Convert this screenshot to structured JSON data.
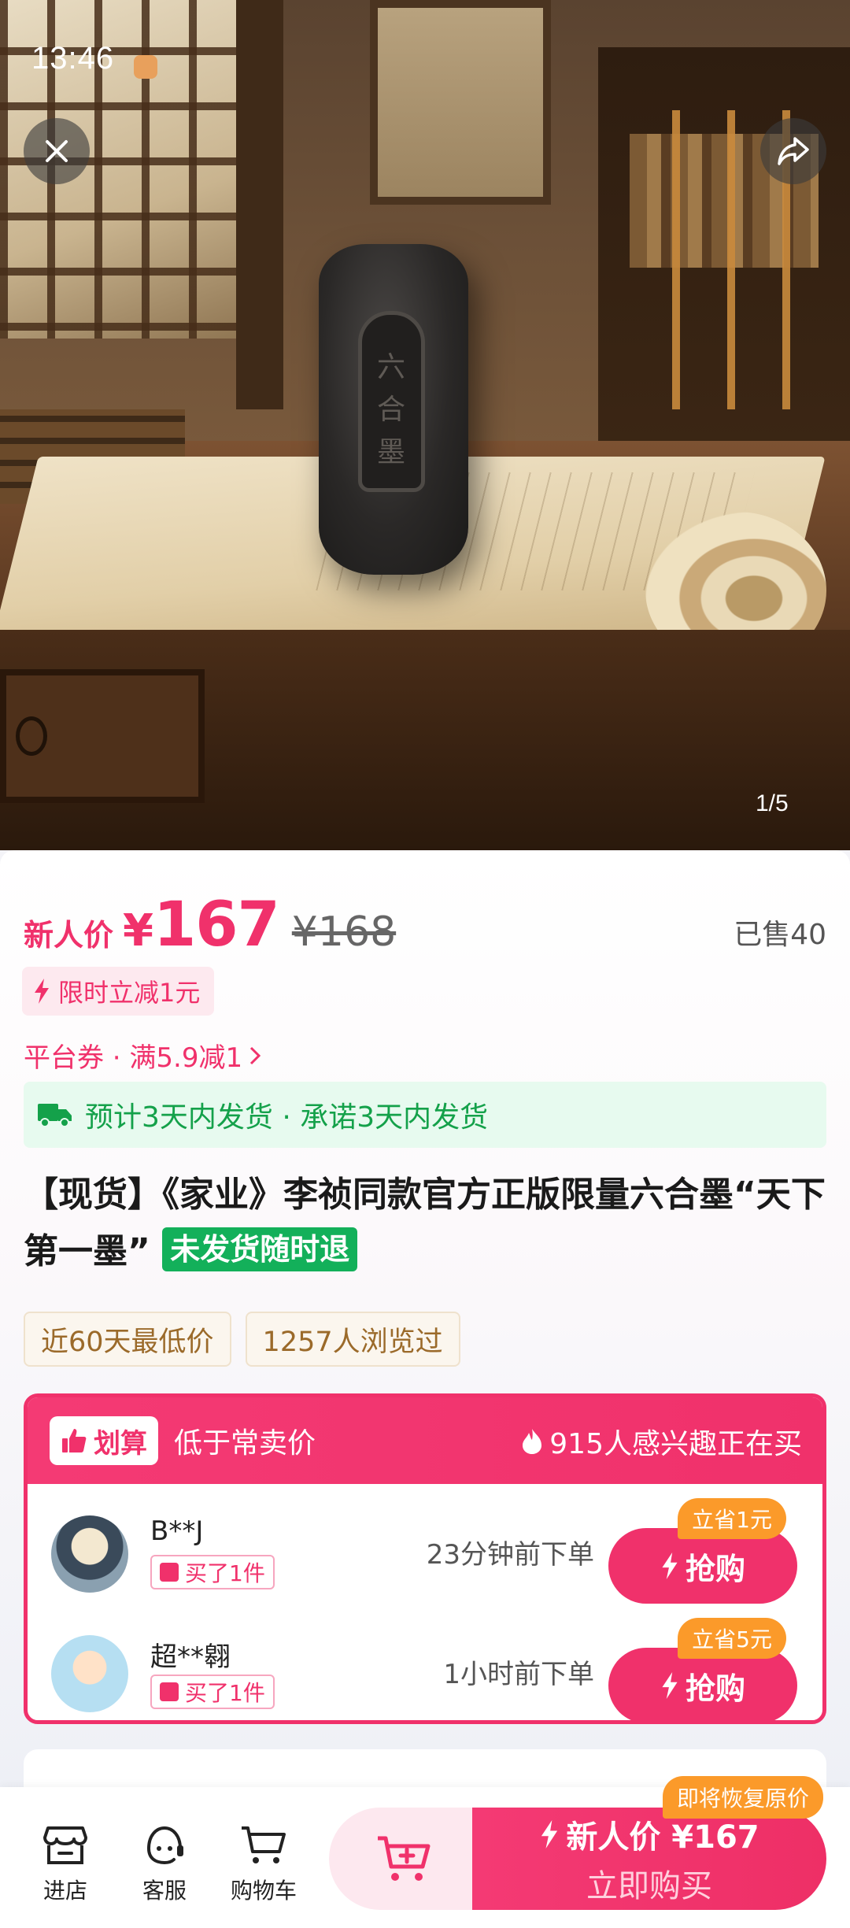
{
  "status_bar": {
    "time": "13:46"
  },
  "gallery": {
    "counter": "1/5",
    "ink_inscription": "六合墨"
  },
  "price": {
    "label": "新人价",
    "currency": "¥",
    "value": "167",
    "original": "¥168",
    "sold": "已售40"
  },
  "promo": {
    "text": "限时立减1元"
  },
  "coupon": {
    "text": "平台券 · 满5.9减1"
  },
  "shipping": {
    "text": "预计3天内发货 · 承诺3天内发货"
  },
  "product": {
    "title": "【现货】《家业》李祯同款官方正版限量六合墨“天下第一墨”",
    "refund_tag": "未发货随时退"
  },
  "badges": [
    "近60天最低价",
    "1257人浏览过"
  ],
  "deal": {
    "chip": "划算",
    "subtitle": "低于常卖价",
    "hot": "915人感兴趣正在买",
    "buyers": [
      {
        "name": "B**J",
        "bought": "买了1件",
        "time": "23分钟前下单",
        "save": "立省1元",
        "button": "抢购"
      },
      {
        "name": "超**翱",
        "bought": "买了1件",
        "time": "1小时前下单",
        "save": "立省5元",
        "button": "抢购"
      }
    ]
  },
  "bottom_bar": {
    "shop": "进店",
    "service": "客服",
    "cart": "购物车",
    "restore_tag": "即将恢复原价",
    "buy_price": "新人价 ¥167",
    "buy_label": "立即购买"
  },
  "colors": {
    "accent": "#f0316b",
    "green": "#13b05a",
    "orange": "#fb9a2a"
  }
}
